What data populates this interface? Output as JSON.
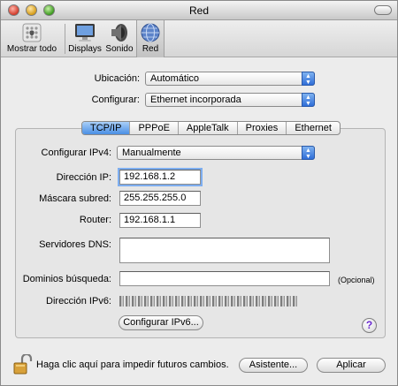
{
  "window": {
    "title": "Red"
  },
  "toolbar": {
    "items": [
      {
        "label": "Mostrar todo",
        "icon": "apple-logo-icon"
      },
      {
        "label": "Displays",
        "icon": "display-icon"
      },
      {
        "label": "Sonido",
        "icon": "speaker-icon"
      },
      {
        "label": "Red",
        "icon": "network-globe-icon"
      }
    ]
  },
  "location": {
    "label": "Ubicación:",
    "value": "Automático"
  },
  "configure": {
    "label": "Configurar:",
    "value": "Ethernet incorporada"
  },
  "tabs": [
    "TCP/IP",
    "PPPoE",
    "AppleTalk",
    "Proxies",
    "Ethernet"
  ],
  "tcpip": {
    "ipv4_label": "Configurar IPv4:",
    "ipv4_value": "Manualmente",
    "ip_label": "Dirección IP:",
    "ip_value": "192.168.1.2",
    "mask_label": "Máscara subred:",
    "mask_value": "255.255.255.0",
    "router_label": "Router:",
    "router_value": "192.168.1.1",
    "dns_label": "Servidores DNS:",
    "dns_value": "",
    "domains_label": "Dominios búsqueda:",
    "domains_value": "",
    "optional_label": "(Opcional)",
    "ipv6_label": "Dirección IPv6:",
    "ipv6_button": "Configurar IPv6..."
  },
  "footer": {
    "lock_text": "Haga clic aquí para impedir futuros cambios.",
    "assistant_button": "Asistente...",
    "apply_button": "Aplicar",
    "help": "?"
  },
  "colors": {
    "accent": "#4a8fe4",
    "help": "#6b2bd0"
  }
}
